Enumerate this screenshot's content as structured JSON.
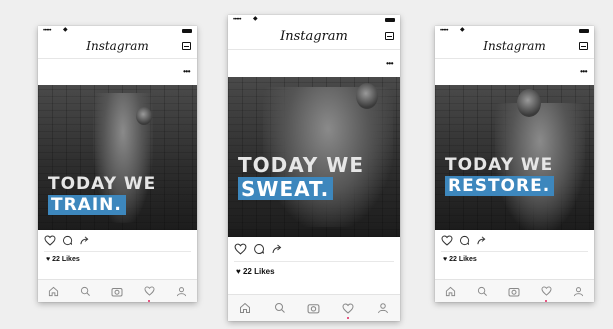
{
  "phones": [
    {
      "id": "p1",
      "app_title": "Instagram",
      "status_dots": "•••••",
      "more_glyph": "•••",
      "caption_line1": "TODAY WE",
      "caption_line2": "TRAIN.",
      "likes": "22 Likes",
      "accent": "#3d87bd"
    },
    {
      "id": "p2",
      "app_title": "Instagram",
      "status_dots": "•••••",
      "more_glyph": "•••",
      "caption_line1": "TODAY WE",
      "caption_line2": "SWEAT.",
      "likes": "22 Likes",
      "accent": "#3d87bd"
    },
    {
      "id": "p3",
      "app_title": "Instagram",
      "status_dots": "•••••",
      "more_glyph": "•••",
      "caption_line1": "TODAY WE",
      "caption_line2": "RESTORE.",
      "likes": "22 Likes",
      "accent": "#3d87bd"
    }
  ],
  "icons": {
    "action": [
      "heart-icon",
      "comment-icon",
      "share-icon"
    ],
    "tabbar": [
      "home-icon",
      "search-icon",
      "camera-icon",
      "heart-icon",
      "profile-icon"
    ]
  },
  "colors": {
    "background": "#efefef",
    "notification_dot": "#e0245e"
  }
}
